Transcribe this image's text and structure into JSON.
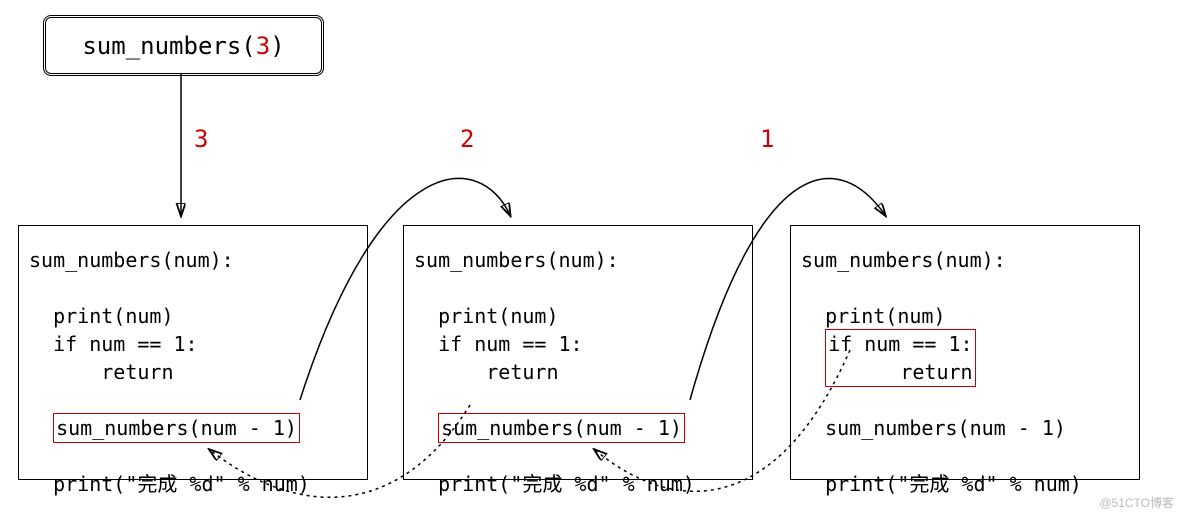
{
  "diagram": {
    "initial_call": {
      "func": "sum_numbers",
      "arg": "3"
    },
    "step_labels": {
      "step1": "3",
      "step2": "2",
      "step3": "1"
    },
    "frame_common": {
      "header": "sum_numbers(num):",
      "l_print": "print(num)",
      "l_if": "if num == 1:",
      "l_ret": "    return",
      "l_recurse": "sum_numbers(num - 1)",
      "l_done": "print(\"完成 %d\" % num)"
    },
    "watermark": "@51CTO博客"
  }
}
